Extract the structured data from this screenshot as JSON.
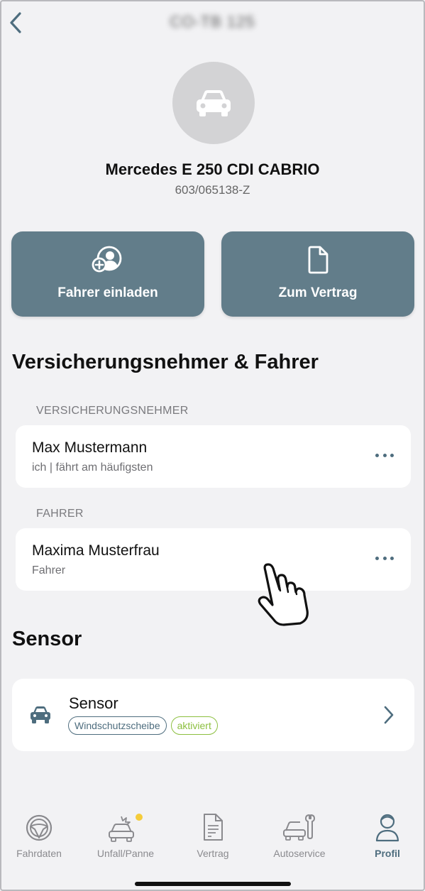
{
  "header": {
    "plate": "CO-TB 125",
    "back_icon": "chevron-left-icon"
  },
  "vehicle": {
    "name": "Mercedes E 250 CDI CABRIO",
    "contract_number": "603/065138-Z"
  },
  "actions": [
    {
      "label": "Fahrer einladen",
      "icon": "add-user-icon"
    },
    {
      "label": "Zum Vertrag",
      "icon": "document-icon"
    }
  ],
  "people_section": {
    "title": "Versicherungsnehmer & Fahrer",
    "policyholder_label": "VERSICHERUNGSNEHMER",
    "policyholder": {
      "name": "Max Mustermann",
      "sub": "ich | fährt am häufigsten"
    },
    "driver_label": "FAHRER",
    "driver": {
      "name": "Maxima Musterfrau",
      "sub": "Fahrer"
    }
  },
  "sensor_section": {
    "title": "Sensor",
    "item": {
      "name": "Sensor",
      "badges": [
        "Windschutzscheibe",
        "aktiviert"
      ]
    }
  },
  "tabbar": {
    "items": [
      {
        "label": "Fahrdaten",
        "icon": "steering-wheel-icon"
      },
      {
        "label": "Unfall/Panne",
        "icon": "car-crash-icon"
      },
      {
        "label": "Vertrag",
        "icon": "contract-icon"
      },
      {
        "label": "Autoservice",
        "icon": "car-service-icon"
      },
      {
        "label": "Profil",
        "icon": "profile-icon"
      }
    ],
    "active": "Profil"
  },
  "colors": {
    "accent": "#627d8a",
    "accent_dark": "#4e6d7e",
    "green": "#8cbf3f",
    "notification_dot": "#f5cc3a",
    "background": "#f2f2f4"
  }
}
